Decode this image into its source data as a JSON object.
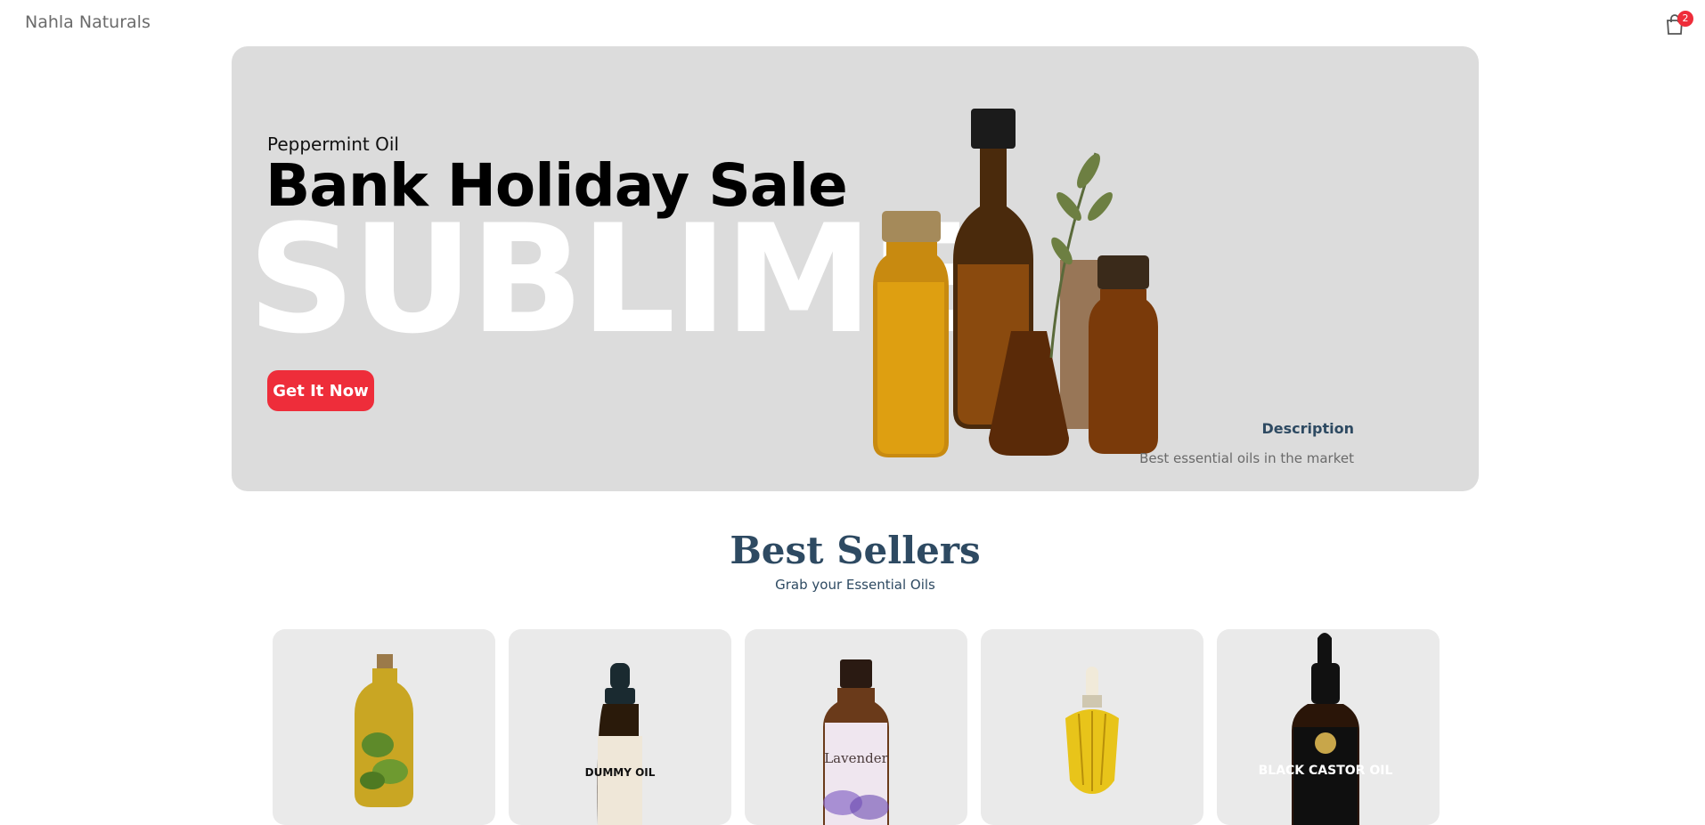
{
  "header": {
    "brand": "Nahla Naturals",
    "cart_count": "2"
  },
  "hero": {
    "subtitle": "Peppermint Oil",
    "title": "Bank Holiday Sale",
    "watermark": "SUBLIME",
    "cta_label": "Get It Now",
    "description_title": "Description",
    "description_text": "Best essential oils in the market"
  },
  "best_sellers": {
    "title": "Best Sellers",
    "subtitle": "Grab your Essential Oils",
    "products": [
      {
        "label": ""
      },
      {
        "label": "DUMMY OIL"
      },
      {
        "label": "Lavender"
      },
      {
        "label": ""
      },
      {
        "label": "BLACK CASTOR OIL"
      }
    ]
  },
  "colors": {
    "accent": "#ee2d3a",
    "heading": "#2e4a62",
    "hero_bg": "#dcdcdc",
    "card_bg": "#eaeaea"
  }
}
